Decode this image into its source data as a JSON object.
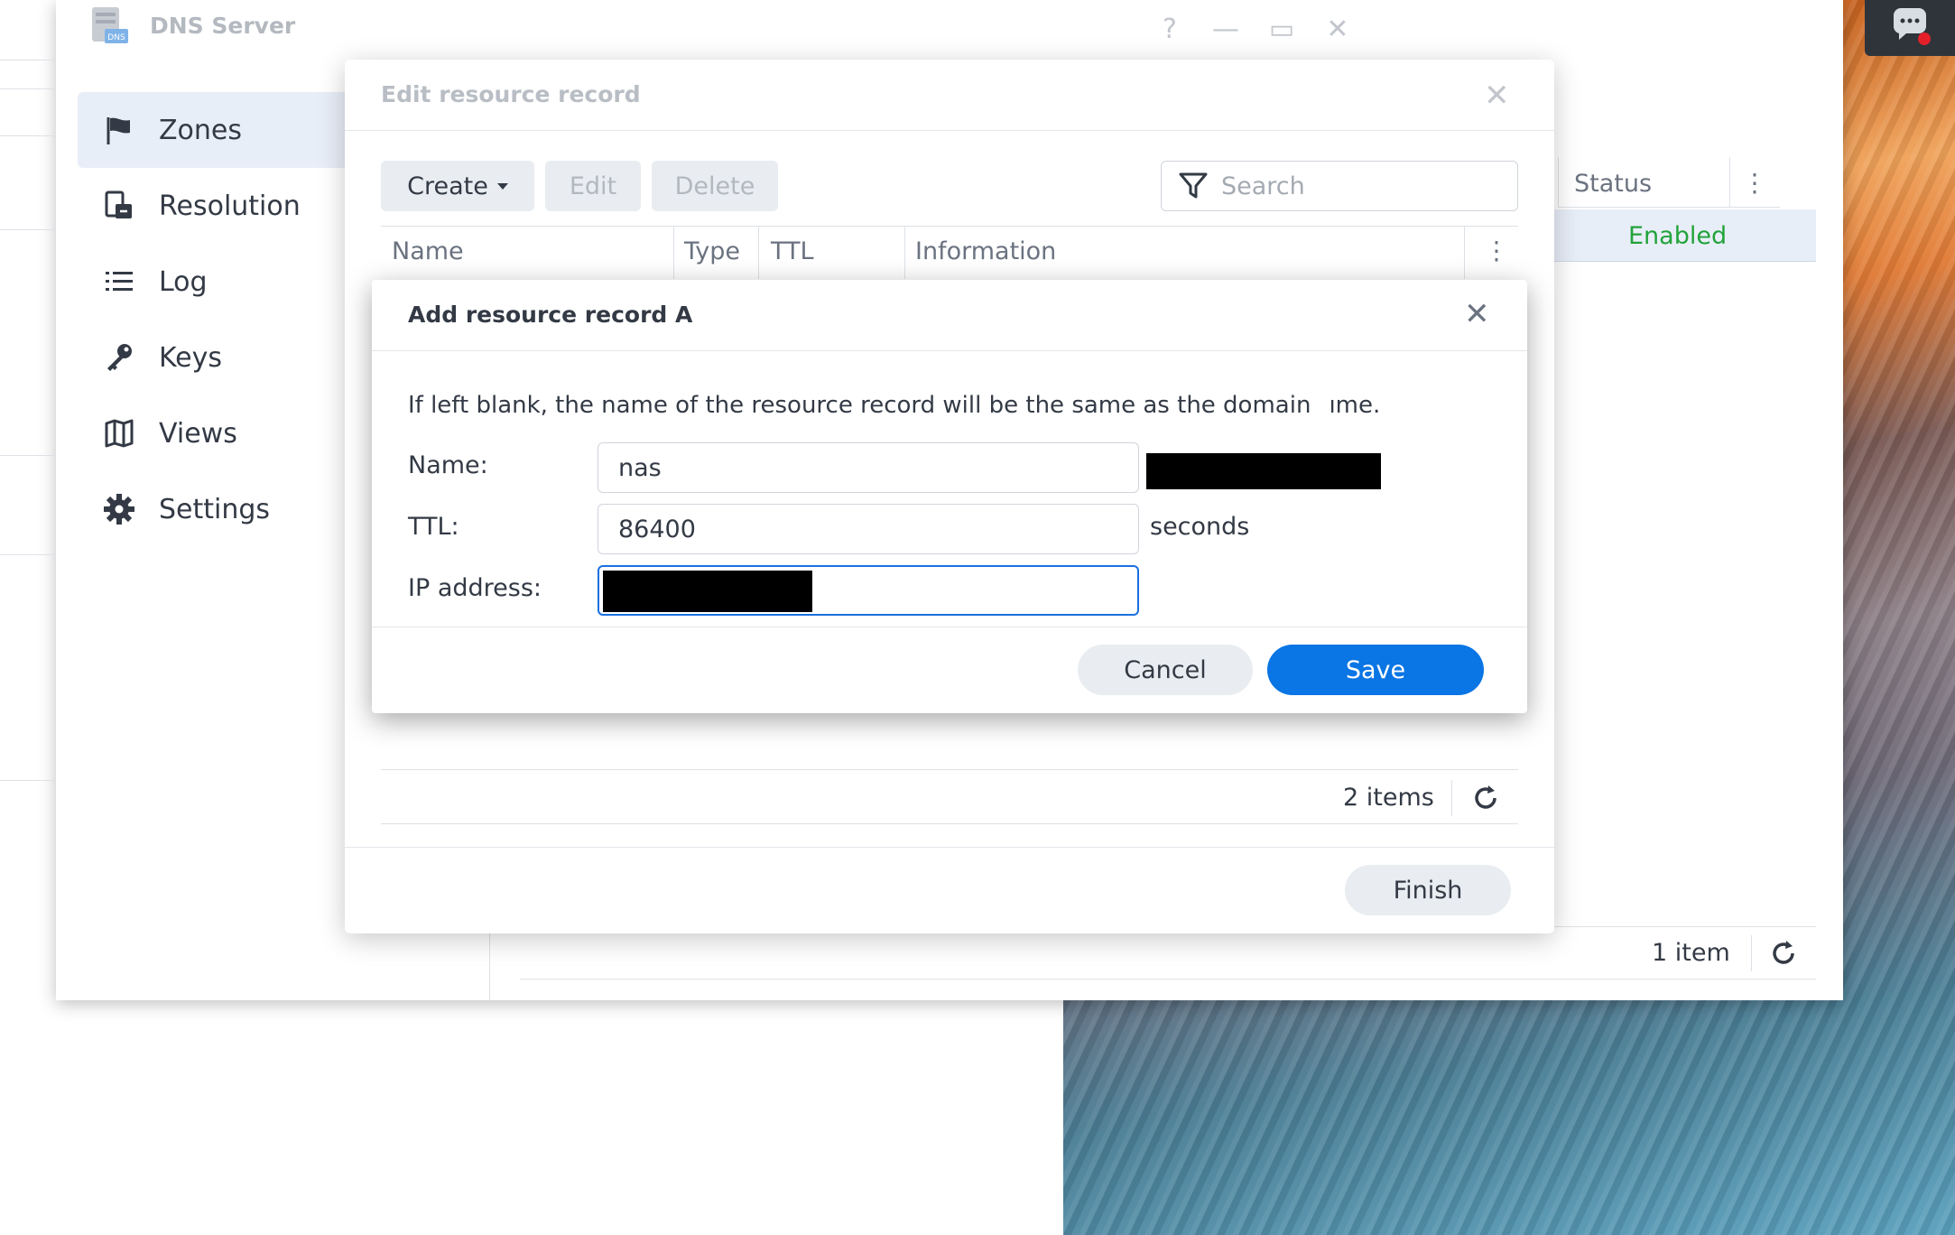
{
  "window": {
    "title": "DNS Server",
    "app_icon_text": "DNS",
    "controls": {
      "help": "?",
      "minimize": "—",
      "maximize": "▭",
      "close": "✕"
    }
  },
  "sidebar": {
    "items": [
      {
        "label": "Zones",
        "icon": "flag-icon",
        "active": true
      },
      {
        "label": "Resolution",
        "icon": "resolution-icon",
        "active": false
      },
      {
        "label": "Log",
        "icon": "list-icon",
        "active": false
      },
      {
        "label": "Keys",
        "icon": "key-icon",
        "active": false
      },
      {
        "label": "Views",
        "icon": "map-icon",
        "active": false
      },
      {
        "label": "Settings",
        "icon": "gear-icon",
        "active": false
      }
    ]
  },
  "zone_list": {
    "columns": {
      "status": "Status"
    },
    "rows": [
      {
        "status": "Enabled"
      }
    ],
    "footer": {
      "count": "1 item"
    }
  },
  "edit_dialog": {
    "title": "Edit resource record",
    "toolbar": {
      "create": "Create",
      "edit": "Edit",
      "delete": "Delete"
    },
    "search": {
      "placeholder": "Search"
    },
    "columns": {
      "name": "Name",
      "type": "Type",
      "ttl": "TTL",
      "information": "Information"
    },
    "footer": {
      "count": "2 items"
    },
    "finish": "Finish"
  },
  "add_dialog": {
    "title": "Add resource record A",
    "description_before": "If left blank, the name of the resource record will be the same as the domain",
    "description_after": "ıme.",
    "fields": {
      "name": {
        "label": "Name:",
        "value": "nas"
      },
      "ttl": {
        "label": "TTL:",
        "value": "86400",
        "unit": "seconds"
      },
      "ip": {
        "label": "IP address:",
        "value": ""
      }
    },
    "cancel": "Cancel",
    "save": "Save"
  },
  "colors": {
    "accent": "#0a75e4",
    "enabled": "#22a33a",
    "active_nav": "#e8eef8"
  }
}
